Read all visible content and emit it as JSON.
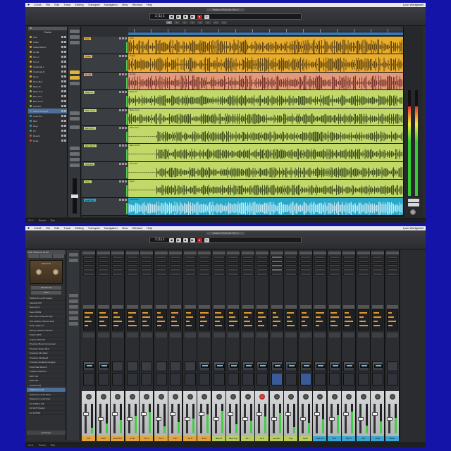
{
  "menubar": {
    "app": "LUNA",
    "items": [
      "File",
      "Edit",
      "Track",
      "Editing",
      "Transport",
      "Navigation",
      "View",
      "Window",
      "Help"
    ],
    "status": "Lyon Wedgewell"
  },
  "top_window": {
    "title": "Ventura Final Mix Rev 2",
    "counter": "2|1|1",
    "tabs": [
      "A",
      "B",
      "C",
      "D",
      "E",
      "F",
      "G",
      "H"
    ],
    "tracklist": {
      "header": "Tracks",
      "items": [
        {
          "name": "Kick",
          "color": "#e2a53a"
        },
        {
          "name": "Snare",
          "color": "#e2a53a"
        },
        {
          "name": "Snare Bottom",
          "color": "#e2a53a"
        },
        {
          "name": "Hi Hat",
          "color": "#e2a53a"
        },
        {
          "name": "Tom 1",
          "color": "#e2a53a"
        },
        {
          "name": "Tom 2",
          "color": "#e2a53a"
        },
        {
          "name": "Overhead L",
          "color": "#e2a53a"
        },
        {
          "name": "Overhead R",
          "color": "#e2a53a"
        },
        {
          "name": "Room",
          "color": "#e2a53a"
        },
        {
          "name": "Drum Bus",
          "color": "#e2a53a"
        },
        {
          "name": "Bass DI",
          "color": "#9ab84a"
        },
        {
          "name": "Bass Amp",
          "color": "#9ab84a"
        },
        {
          "name": "Elec Gtr L",
          "color": "#9ab84a"
        },
        {
          "name": "Elec Gtr R",
          "color": "#9ab84a"
        },
        {
          "name": "Acoustic",
          "color": "#9ab84a"
        },
        {
          "name": "Piano Prototype",
          "color": "#4c8ec4"
        },
        {
          "name": "Lead Vox",
          "color": "#4c8ec4"
        },
        {
          "name": "BGV",
          "color": "#4c8ec4"
        },
        {
          "name": "Keys",
          "color": "#4c8ec4"
        },
        {
          "name": "FX",
          "color": "#4c8ec4"
        },
        {
          "name": "Reverb",
          "color": "#c94d4d"
        },
        {
          "name": "Delay",
          "color": "#c94d4d"
        }
      ]
    },
    "lanes": [
      {
        "name": "Kick",
        "color": "#e9ad2c",
        "wave": "dark"
      },
      {
        "name": "Snare",
        "color": "#e9ad2c",
        "wave": "dark"
      },
      {
        "name": "Hi Hat",
        "color": "#e29a7a",
        "wave": "red"
      },
      {
        "name": "Bass DI",
        "color": "#c2d96a",
        "wave": "green"
      },
      {
        "name": "Bass Amp",
        "color": "#c2d96a",
        "wave": "green"
      },
      {
        "name": "Elec Gtr L",
        "color": "#c2d96a",
        "wave": "green"
      },
      {
        "name": "Elec Gtr R",
        "color": "#c2d96a",
        "wave": "green"
      },
      {
        "name": "Acoustic",
        "color": "#c2d96a",
        "wave": "green"
      },
      {
        "name": "Keys",
        "color": "#c2d96a",
        "wave": "green"
      },
      {
        "name": "Lead Vox",
        "color": "#2aa8c8",
        "wave": "cyan"
      }
    ],
    "statusbar": [
      "2.1.1",
      "Punch",
      "Dim"
    ]
  },
  "bottom_window": {
    "title": "Ventura Final Mix Rev 2",
    "counter": "2|1|1",
    "browser": {
      "header": "UAD Teletronix LA-2A",
      "plugin_label": "Teletronix",
      "buttons": [
        "Bundle Off",
        "Insert"
      ],
      "presets": [
        "Teletronix LA-2A Legacy",
        "Fairchild 670",
        "Neve 1073",
        "Neve 33609",
        "API Vision Channel Strip",
        "SSL 4000 E Channel Strip",
        "Pultec EQP-1A",
        "Manley Massive Passive",
        "Studer A800",
        "Ampex ATR-102",
        "Precision Buss Compressor",
        "Precision Delay Mod",
        "Precision Mix Rack",
        "Precision Multiband",
        "Precision Reflection Engine",
        "Pure Plate Reverb",
        "Capitol Chambers",
        "EMT 140",
        "EMT 250",
        "Lexicon 224",
        "Teletronix LA-2",
        "Teletronix LA-2A Silver",
        "Teletronix LA-2A Gray",
        "UA 175B & 176",
        "UA 1176 Classic",
        "UA 1176AE"
      ],
      "selected_index": 20,
      "footer": "Add Plugin"
    },
    "channels": [
      {
        "name": "Kick",
        "color": "#e2a53a"
      },
      {
        "name": "Snare",
        "color": "#e2a53a"
      },
      {
        "name": "Snare Btm",
        "color": "#e2a53a"
      },
      {
        "name": "Hi Hat",
        "color": "#e2a53a"
      },
      {
        "name": "Tom 1",
        "color": "#e2a53a"
      },
      {
        "name": "Tom 2",
        "color": "#e2a53a"
      },
      {
        "name": "OH L",
        "color": "#e2a53a"
      },
      {
        "name": "OH R",
        "color": "#e2a53a"
      },
      {
        "name": "Room",
        "color": "#e2a53a"
      },
      {
        "name": "Bass DI",
        "color": "#b9cf5c"
      },
      {
        "name": "Bass Amp",
        "color": "#b9cf5c"
      },
      {
        "name": "Gtr L",
        "color": "#b9cf5c"
      },
      {
        "name": "Gtr R",
        "color": "#b9cf5c"
      },
      {
        "name": "Acoustic",
        "color": "#b9cf5c"
      },
      {
        "name": "Keys",
        "color": "#b9cf5c"
      },
      {
        "name": "Piano",
        "color": "#b9cf5c"
      },
      {
        "name": "Lead Vox",
        "color": "#3aa7d0"
      },
      {
        "name": "BGV",
        "color": "#3aa7d0"
      },
      {
        "name": "BGV 2",
        "color": "#3aa7d0"
      },
      {
        "name": "Verb",
        "color": "#3aa7d0"
      },
      {
        "name": "Delay",
        "color": "#3aa7d0"
      },
      {
        "name": "Master",
        "color": "#3aa7d0"
      }
    ],
    "statusbar": [
      "2.1.1",
      "Punch",
      "Dim"
    ]
  }
}
